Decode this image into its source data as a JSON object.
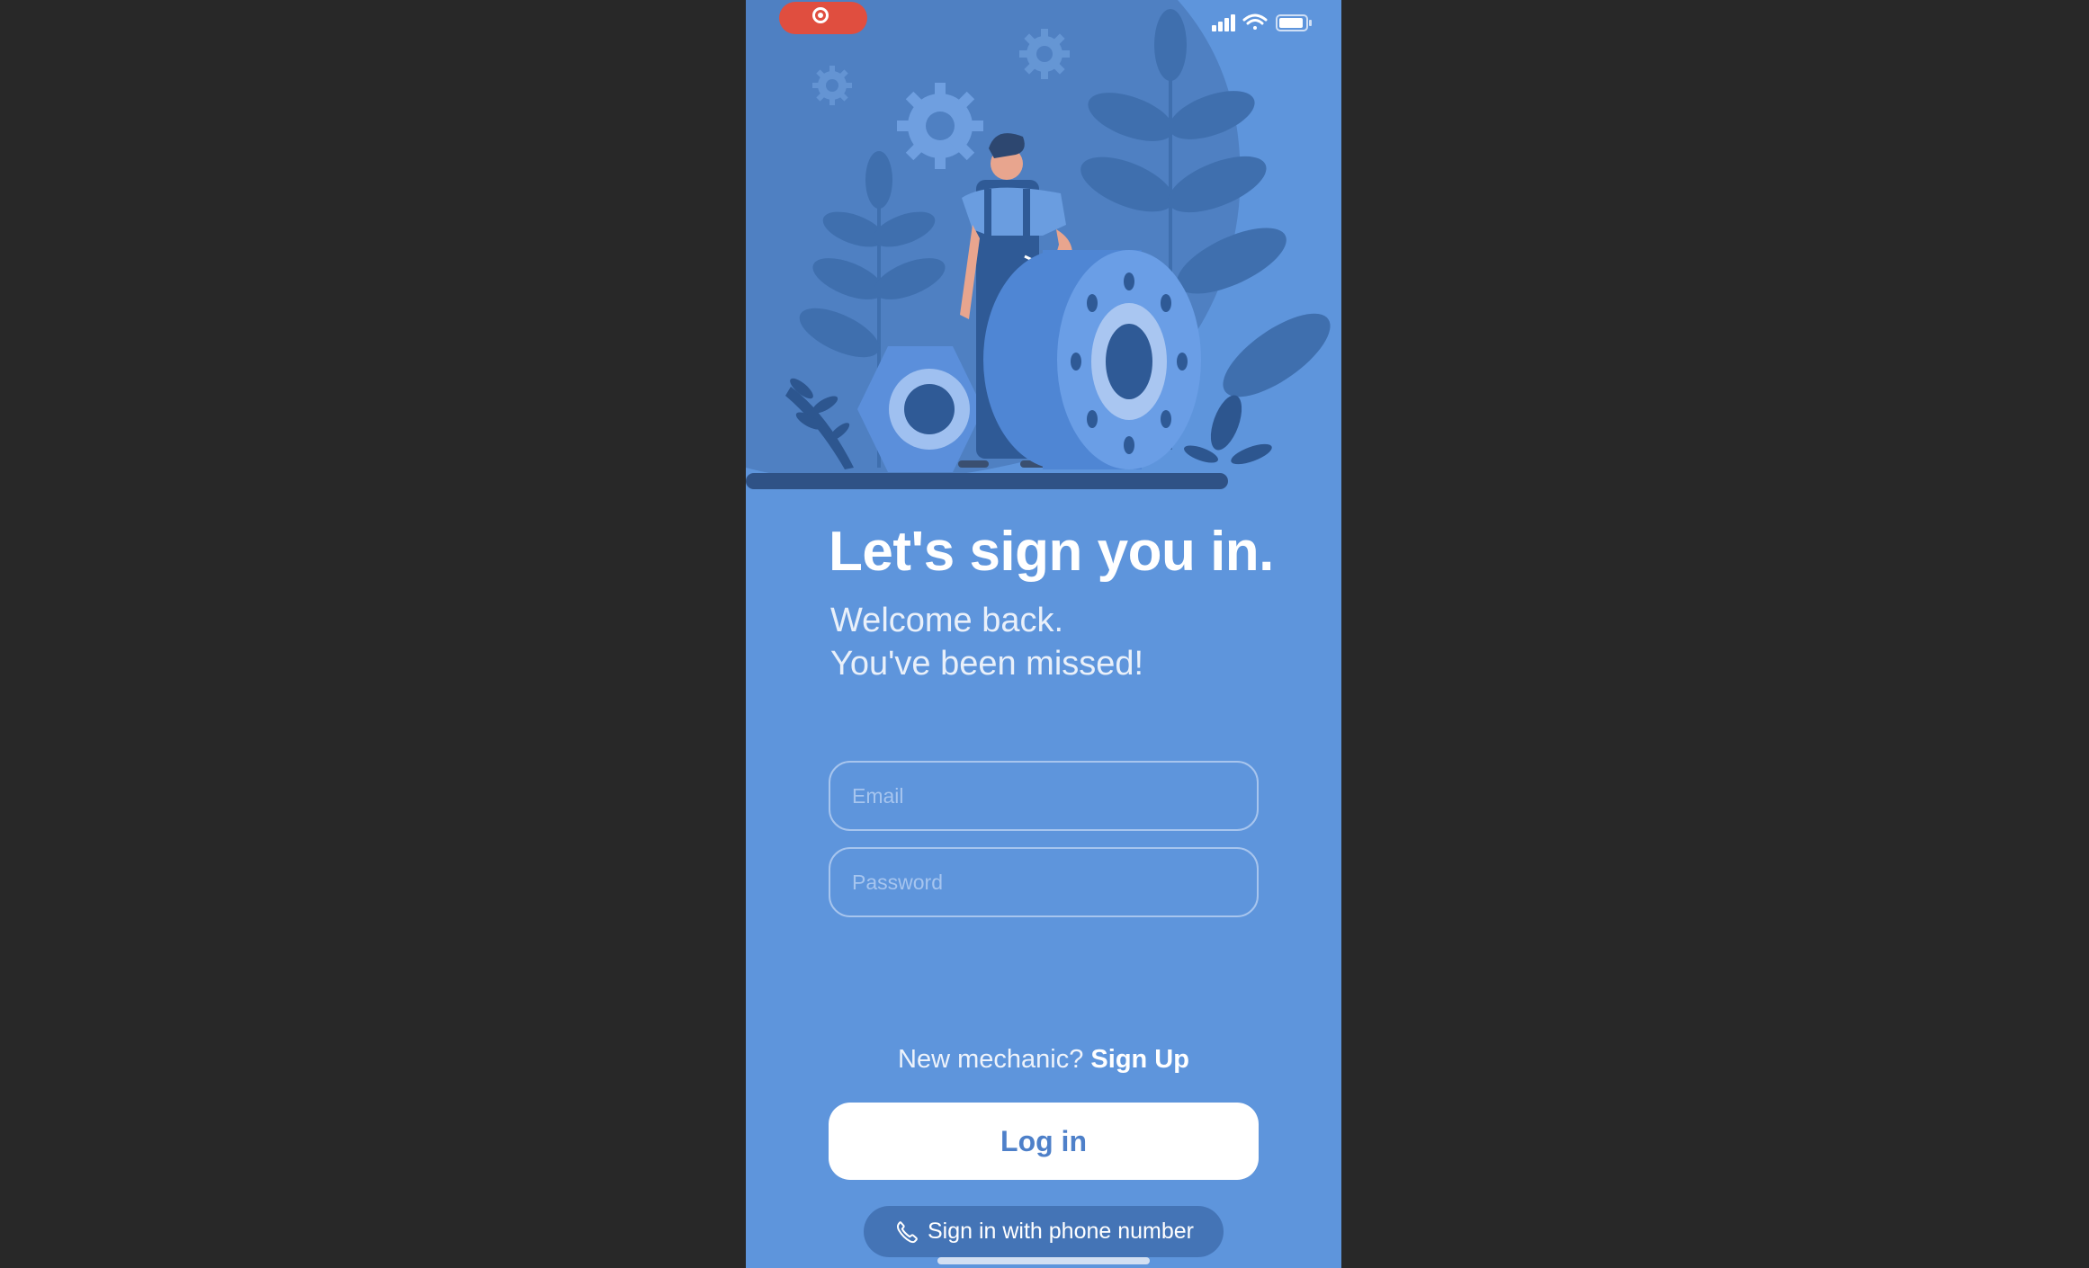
{
  "title": "Let's sign you in.",
  "subtitle_line1": "Welcome back.",
  "subtitle_line2": "You've been missed!",
  "form": {
    "email_placeholder": "Email",
    "email_value": "",
    "password_placeholder": "Password",
    "password_value": ""
  },
  "signup": {
    "prompt": "New mechanic?",
    "link": "Sign Up"
  },
  "login_button": "Log in",
  "phone_signin": {
    "label": "Sign in with phone number",
    "icon": "phone-icon"
  },
  "status_bar": {
    "icons": [
      "screen-recording-icon",
      "signal-icon",
      "wifi-icon",
      "battery-icon"
    ]
  },
  "colors": {
    "background": "#5e95dc",
    "accent": "#4e80c9",
    "recording": "#e04e3f"
  }
}
